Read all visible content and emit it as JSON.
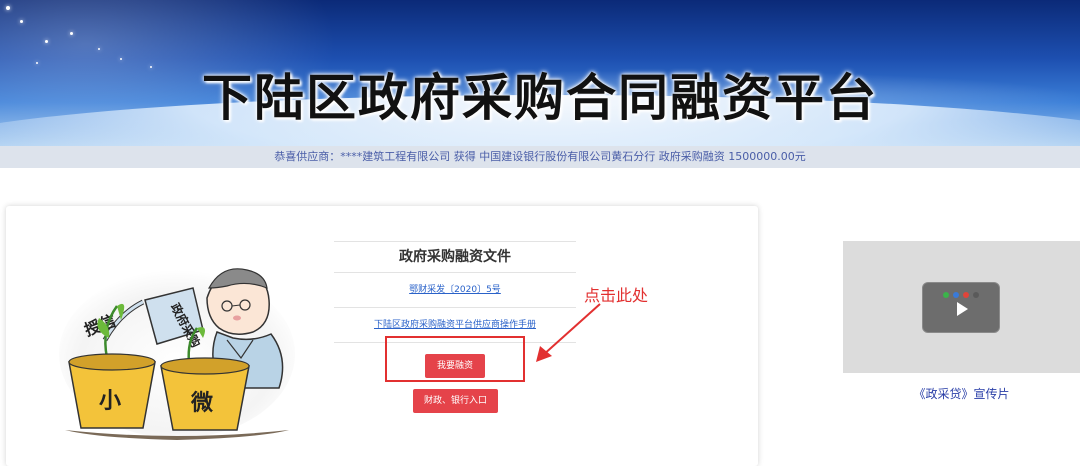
{
  "header": {
    "title": "下陆区政府采购合同融资平台"
  },
  "ticker": {
    "text": "恭喜供应商：****建筑工程有限公司 获得 中国建设银行股份有限公司黄石分行 政府采购融资 1500000.00元"
  },
  "illustration": {
    "can_label": "政府采购",
    "left_label": "授信",
    "pot_left": "小",
    "pot_right": "微"
  },
  "documents": {
    "title": "政府采购融资文件",
    "links": [
      "鄂财采发〔2020〕5号",
      "下陆区政府采购融资平台供应商操作手册"
    ]
  },
  "buttons": {
    "apply": "我要融资",
    "gov_bank": "财政、银行入口"
  },
  "annotation": {
    "text": "点击此处",
    "color": "#e23030"
  },
  "video": {
    "caption": "《政采贷》宣传片",
    "play_icon": "play-icon"
  },
  "colors": {
    "accent_red": "#e5434a",
    "link_blue": "#2a62c9",
    "ticker_bg": "#dde3ec"
  }
}
